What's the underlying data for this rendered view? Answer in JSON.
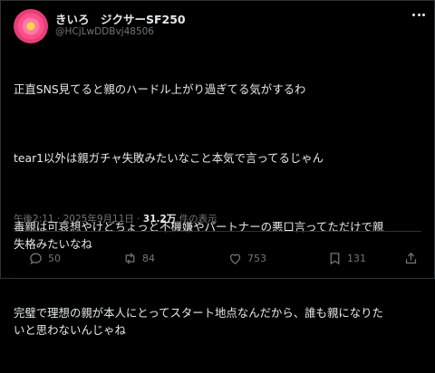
{
  "author": {
    "display_name": "きいろ　ジクサーSF250",
    "handle": "@HCjLwDDBvj48506"
  },
  "tweet": {
    "paragraphs": [
      "正直SNS見てると親のハードル上がり過ぎてる気がするわ",
      "tear1以外は親ガチャ失敗みたいなこと本気で言ってるじゃん",
      "毒親は可哀想やけどちょっと不機嫌やパートナーの悪口言ってただけで親\n失格みたいなね",
      "完璧で理想の親が本人にとってスタート地点なんだから、誰も親になりた\nいと思わないんじゃね"
    ]
  },
  "meta": {
    "time": "午後2:11",
    "sep1": " · ",
    "date": "2025年9月11日",
    "sep2": " · ",
    "views": "31.2万",
    "views_suffix": " 件の表示"
  },
  "actions": {
    "replies": "50",
    "retweets": "84",
    "likes": "753",
    "bookmarks": "131"
  },
  "colors": {
    "background": "#000000",
    "text": "#e7e9ea",
    "muted": "#71767b",
    "border": "#2f3336"
  },
  "icons": [
    "reply-icon",
    "retweet-icon",
    "like-icon",
    "bookmark-icon",
    "share-icon",
    "more-icon"
  ]
}
